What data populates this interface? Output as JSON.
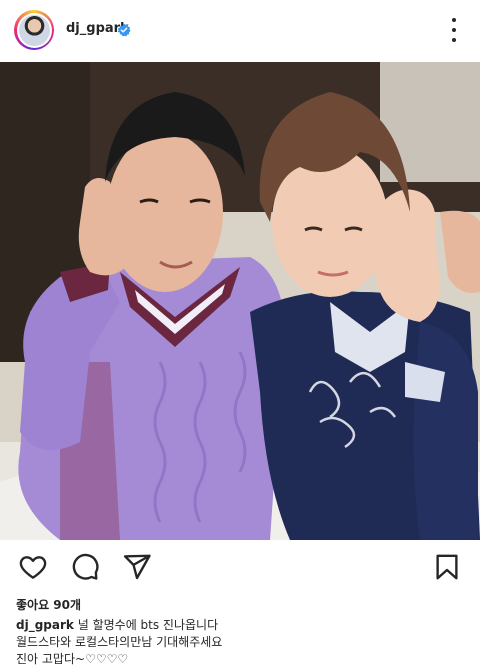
{
  "post": {
    "username": "dj_gpark",
    "verified": true,
    "likes": "좋아요 90개",
    "caption_lines": [
      "널 할명수에 bts 진나옵니다",
      "월드스타와 로컬스타의만남 기대해주세요",
      "진아 고맙다~♡♡♡♡"
    ]
  },
  "icons": {
    "verified": "verified-badge-icon",
    "more": "more-options-icon",
    "like": "heart-icon",
    "comment": "comment-icon",
    "share": "send-icon",
    "save": "bookmark-icon"
  },
  "colors": {
    "text": "#262626",
    "verified": "#3897f0",
    "sweater_purple": "#a58bd6",
    "sweater_navy": "#1f2a55"
  }
}
